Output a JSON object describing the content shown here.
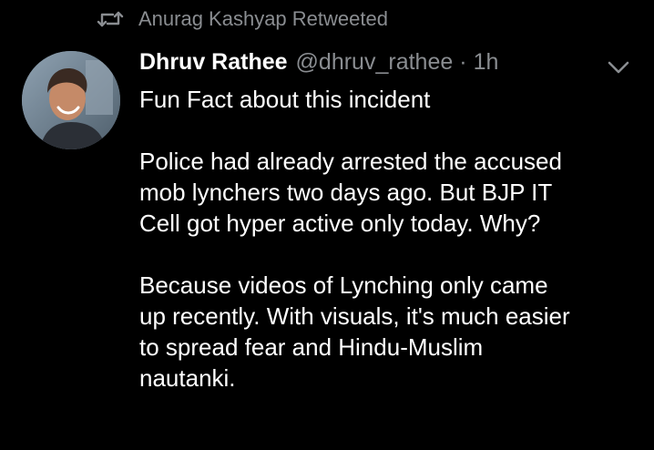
{
  "retweet": {
    "icon": "retweet-icon",
    "label": "Anurag Kashyap Retweeted"
  },
  "author": {
    "avatar": "avatar",
    "display_name": "Dhruv Rathee",
    "handle": "@dhruv_rathee",
    "separator": "·",
    "time": "1h"
  },
  "menu": {
    "icon": "chevron-down-icon"
  },
  "tweet": {
    "intro": "Fun Fact about this incident",
    "para1_lines": [
      "Police had already arrested the accused",
      "mob lynchers two days ago. But BJP IT",
      "Cell got hyper active only today. Why?"
    ],
    "para2_lines": [
      "Because videos of Lynching only came",
      "up recently. With visuals, it's much easier",
      "to spread fear and Hindu-Muslim",
      "nautanki."
    ]
  },
  "colors": {
    "background": "#000000",
    "primary_text": "#ffffff",
    "secondary_text": "#8a8d91"
  }
}
